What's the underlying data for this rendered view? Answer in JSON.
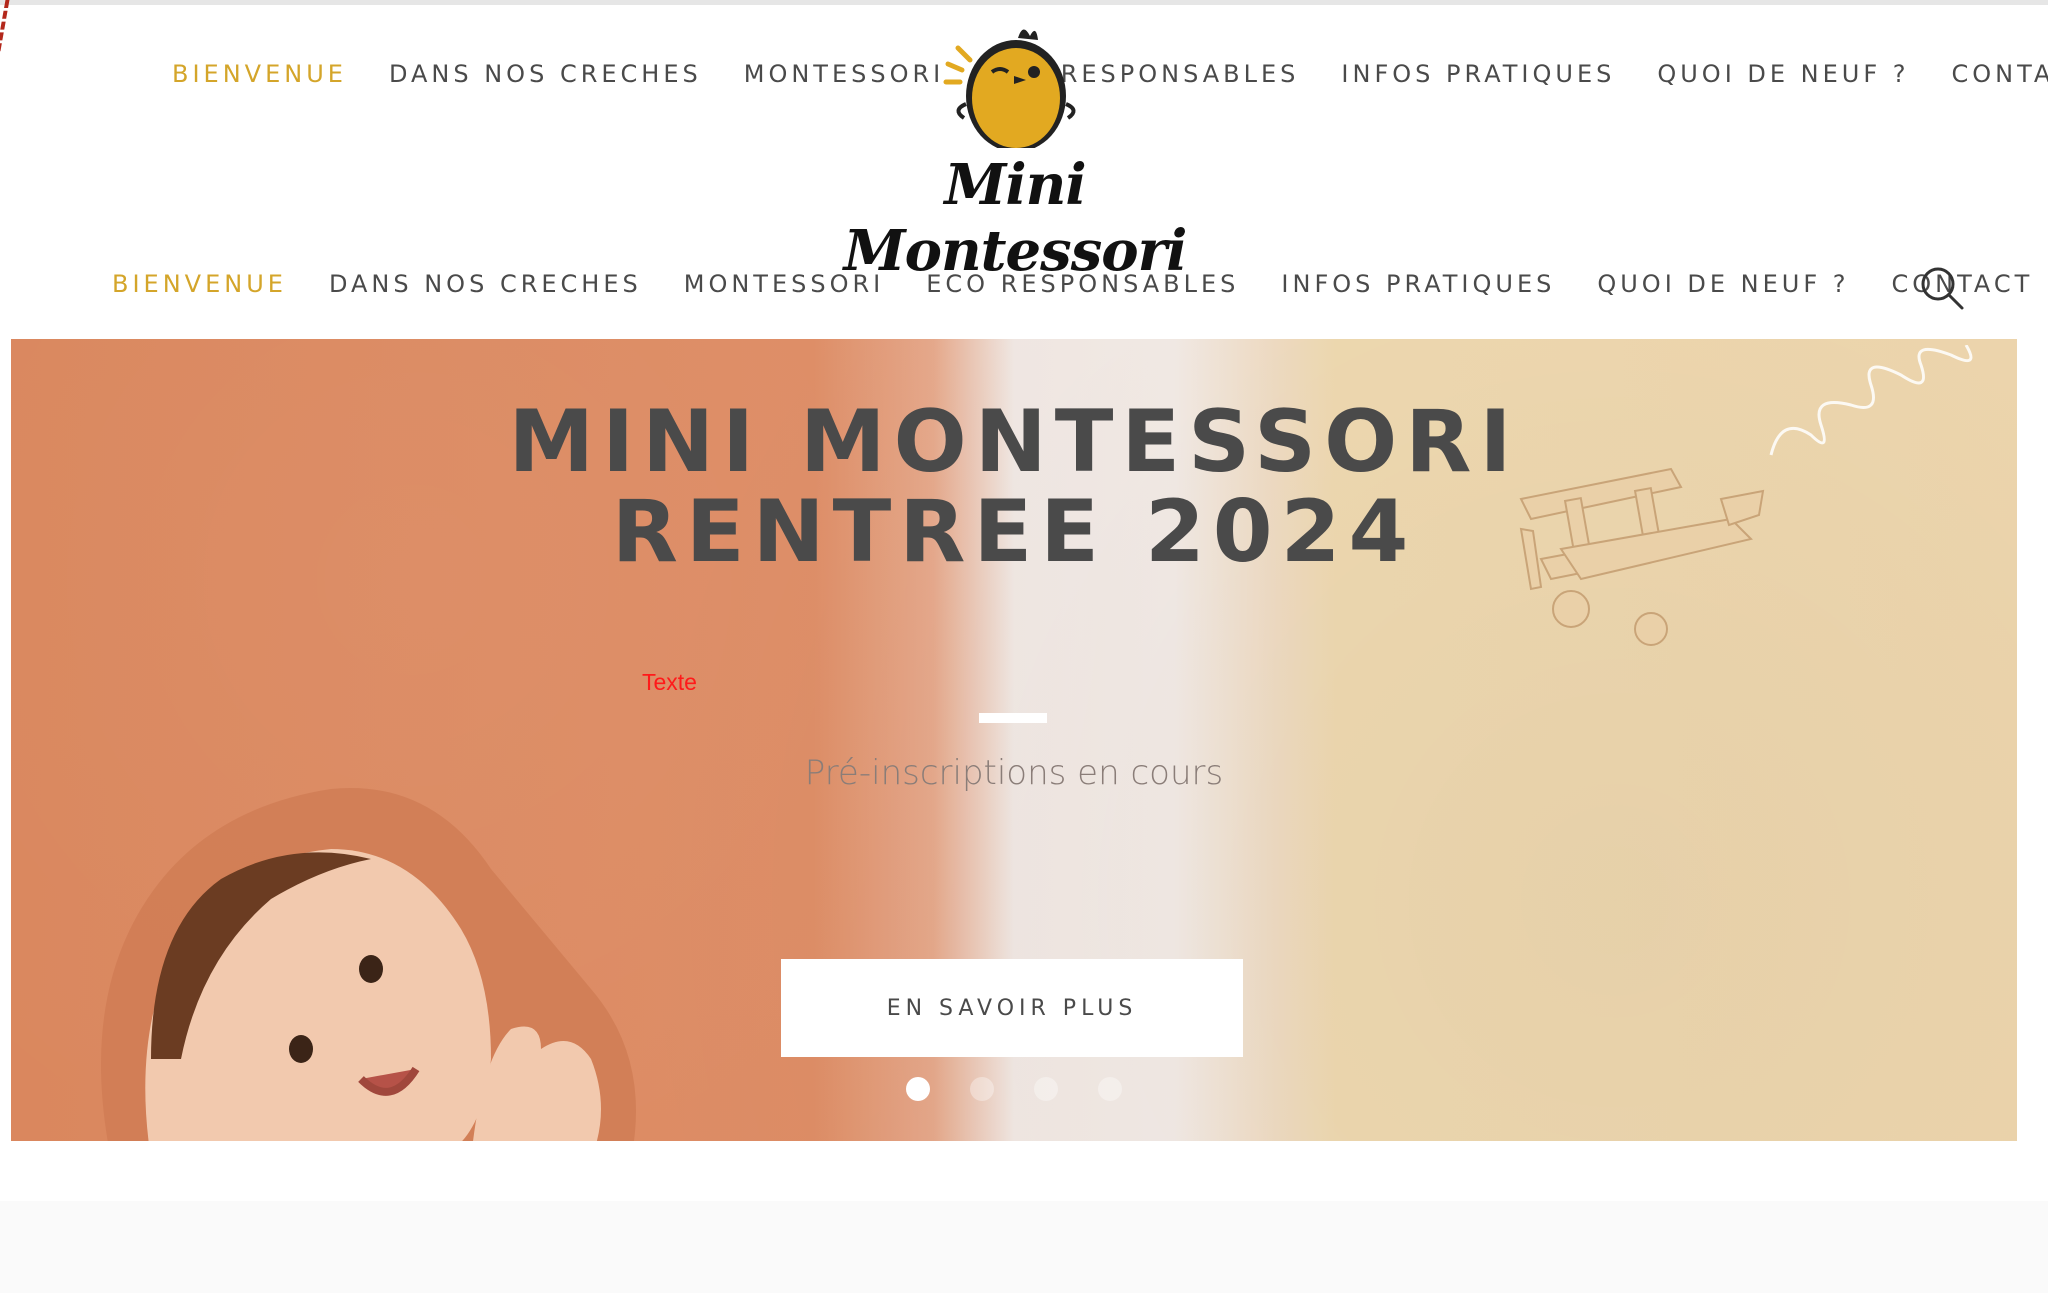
{
  "colors": {
    "accent": "#d4a52a",
    "nav_text": "#4a4a4a",
    "hero_left": "#dd8b63",
    "hero_right": "#efd7ae",
    "red_label": "#ff1a1a"
  },
  "top_nav": {
    "items": [
      {
        "label": "BIENVENUE",
        "active": true
      },
      {
        "label": "DANS NOS CRECHES",
        "active": false
      },
      {
        "label": "MONTESSORI",
        "active": false
      },
      {
        "label": "ECO RESPONSABLES",
        "active": false
      },
      {
        "label": "INFOS PRATIQUES",
        "active": false
      },
      {
        "label": "QUOI DE NEUF ?",
        "active": false
      },
      {
        "label": "CONTACT",
        "active": false
      }
    ]
  },
  "logo": {
    "text": "Mini Montessori",
    "icon": "chick-icon"
  },
  "main_nav": {
    "items": [
      {
        "label": "BIENVENUE",
        "active": true
      },
      {
        "label": "DANS NOS CRECHES",
        "active": false
      },
      {
        "label": "MONTESSORI",
        "active": false
      },
      {
        "label": "ECO RESPONSABLES",
        "active": false
      },
      {
        "label": "INFOS PRATIQUES",
        "active": false
      },
      {
        "label": "QUOI DE NEUF ?",
        "active": false
      },
      {
        "label": "CONTACT",
        "active": false
      }
    ],
    "search_icon": "search-icon"
  },
  "hero": {
    "title_line1": "MINI MONTESSORI",
    "title_line2": "RENTREE 2024",
    "label": "Texte",
    "subtitle": "Pré-inscriptions en cours",
    "cta_label": "EN SAVOIR PLUS",
    "slides_total": 4,
    "active_slide": 1
  }
}
